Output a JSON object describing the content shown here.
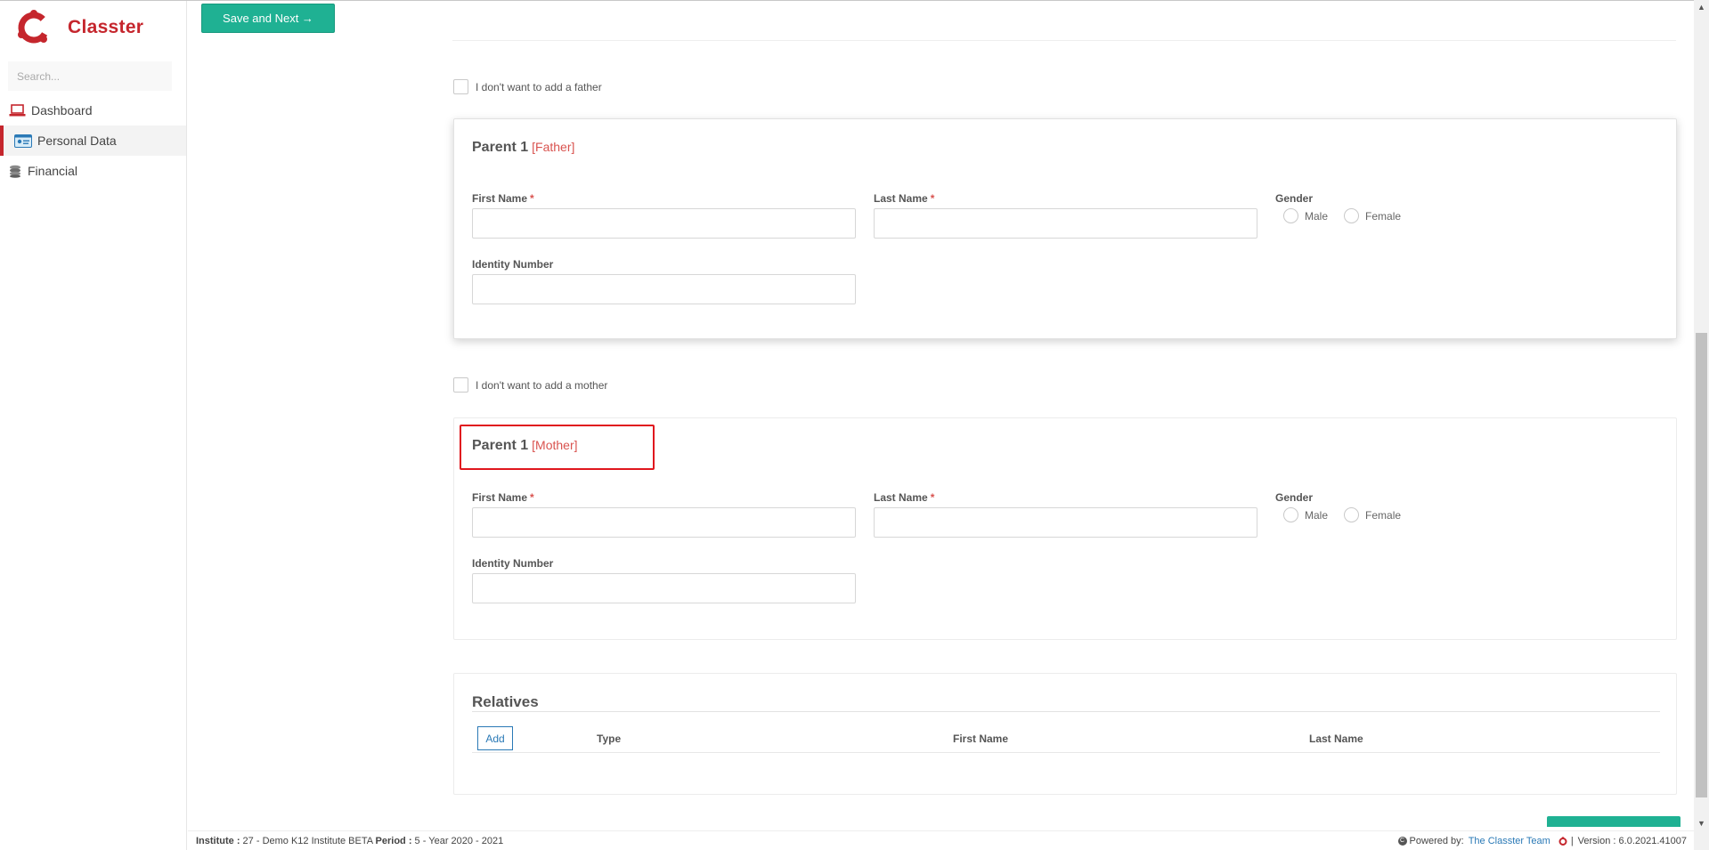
{
  "app": {
    "brand": "Classter"
  },
  "colors": {
    "brand": "#c5262d",
    "primary_button": "#1fb193",
    "required": "#d9534f",
    "link": "#2a79b6",
    "highlight": "#e0161e"
  },
  "sidebar": {
    "search_placeholder": "Search...",
    "items": [
      {
        "label": "Dashboard",
        "icon": "laptop-icon",
        "active": false
      },
      {
        "label": "Personal Data",
        "icon": "id-card-icon",
        "active": true
      },
      {
        "label": "Financial",
        "icon": "coins-icon",
        "active": false
      }
    ]
  },
  "toolbar": {
    "save_next_label": "Save and Next →"
  },
  "father_section": {
    "checkbox_label": "I don't want to add a father",
    "title": "Parent 1",
    "tag": "[Father]",
    "first_name_label": "First Name",
    "last_name_label": "Last Name",
    "gender_label": "Gender",
    "gender_options": [
      "Male",
      "Female"
    ],
    "identity_label": "Identity Number",
    "required_mark": "*"
  },
  "mother_section": {
    "checkbox_label": "I don't want to add a mother",
    "title": "Parent 1",
    "tag": "[Mother]",
    "first_name_label": "First Name",
    "last_name_label": "Last Name",
    "gender_label": "Gender",
    "gender_options": [
      "Male",
      "Female"
    ],
    "identity_label": "Identity Number",
    "required_mark": "*"
  },
  "relatives": {
    "title": "Relatives",
    "add_label": "Add",
    "columns": [
      "Type",
      "First Name",
      "Last Name"
    ]
  },
  "footer": {
    "institute_label": "Institute :",
    "institute_value": " 27 - Demo K12 Institute BETA ",
    "period_label": "Period :",
    "period_value": " 5 - Year 2020 - 2021",
    "powered_by": "Powered by:",
    "team_link": "The Classter Team",
    "separator": "|",
    "version": "Version : 6.0.2021.41007"
  }
}
